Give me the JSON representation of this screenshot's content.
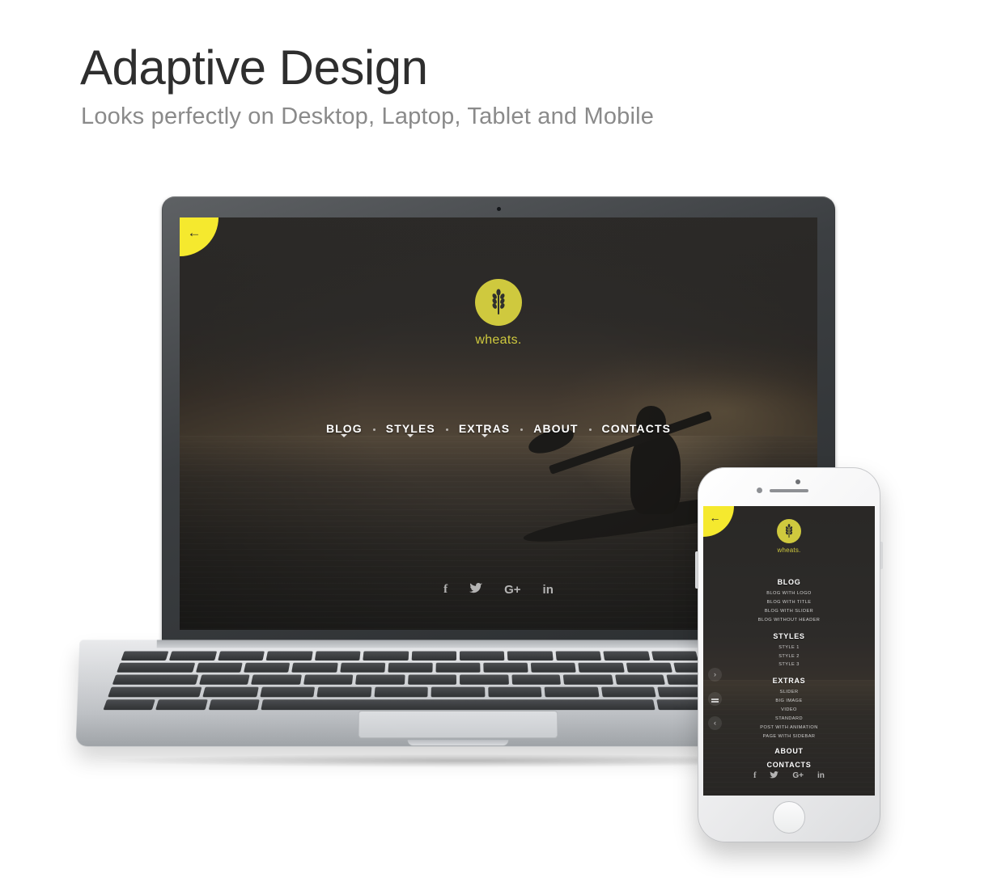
{
  "header": {
    "headline": "Adaptive Design",
    "subheadline": "Looks perfectly on Desktop, Laptop, Tablet and Mobile"
  },
  "colors": {
    "logo_yellow": "#cfc93e",
    "tab_yellow": "#f5e92e",
    "headline_gray": "#2e2e2e",
    "subhead_gray": "#8a8a8a",
    "screen_dark": "#2b2b29"
  },
  "laptop": {
    "device": "laptop",
    "corner_tab": {
      "icon": "arrow-left-icon",
      "glyph": "←"
    },
    "brand": {
      "name": "wheats.",
      "logo_icon": "wheat-icon"
    },
    "nav": [
      {
        "label": "BLOG",
        "has_dropdown": true
      },
      {
        "label": "STYLES",
        "has_dropdown": true
      },
      {
        "label": "EXTRAS",
        "has_dropdown": true
      },
      {
        "label": "ABOUT",
        "has_dropdown": false
      },
      {
        "label": "CONTACTS",
        "has_dropdown": false
      }
    ],
    "social": [
      {
        "name": "facebook-icon",
        "glyph": "f"
      },
      {
        "name": "twitter-icon",
        "glyph": "ᴠ"
      },
      {
        "name": "google-plus-icon",
        "glyph": "G+"
      },
      {
        "name": "linkedin-icon",
        "glyph": "in"
      }
    ]
  },
  "phone": {
    "device": "smartphone",
    "corner_tab": {
      "icon": "arrow-left-icon",
      "glyph": "←"
    },
    "brand": {
      "name": "wheats.",
      "logo_icon": "wheat-icon"
    },
    "menu": [
      {
        "heading": "BLOG",
        "items": [
          "BLOG WITH LOGO",
          "BLOG WITH TITLE",
          "BLOG WITH SLIDER",
          "BLOG WITHOUT HEADER"
        ]
      },
      {
        "heading": "STYLES",
        "items": [
          "STYLE 1",
          "STYLE 2",
          "STYLE 3"
        ]
      },
      {
        "heading": "EXTRAS",
        "items": [
          "SLIDER",
          "BIG IMAGE",
          "VIDEO",
          "STANDARD",
          "POST WITH ANIMATION",
          "PAGE WITH SIDEBAR"
        ]
      },
      {
        "heading": "ABOUT",
        "items": []
      },
      {
        "heading": "CONTACTS",
        "items": []
      }
    ],
    "controls": [
      {
        "name": "next-slide-button",
        "glyph": "›"
      },
      {
        "name": "menu-toggle-button",
        "glyph": ""
      },
      {
        "name": "prev-slide-button",
        "glyph": "‹"
      }
    ],
    "social": [
      {
        "name": "facebook-icon",
        "glyph": "f"
      },
      {
        "name": "twitter-icon",
        "glyph": "ᴠ"
      },
      {
        "name": "google-plus-icon",
        "glyph": "G+"
      },
      {
        "name": "linkedin-icon",
        "glyph": "in"
      }
    ]
  }
}
